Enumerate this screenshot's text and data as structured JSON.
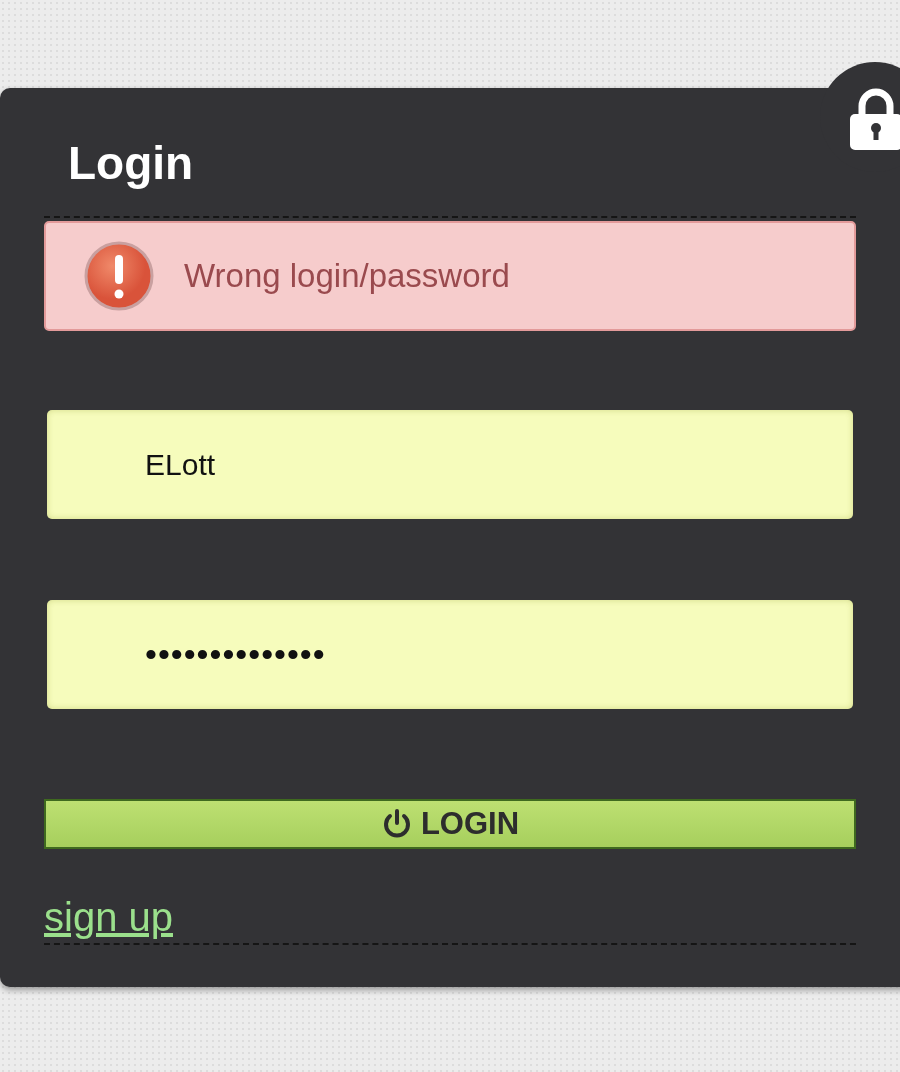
{
  "title": "Login",
  "error": {
    "message": "Wrong login/password"
  },
  "fields": [
    {
      "kind": "text",
      "value": "ELott"
    },
    {
      "kind": "password",
      "value": "••••••••••••••"
    }
  ],
  "submit": {
    "label": "LOGIN"
  },
  "signup_link": "sign up"
}
